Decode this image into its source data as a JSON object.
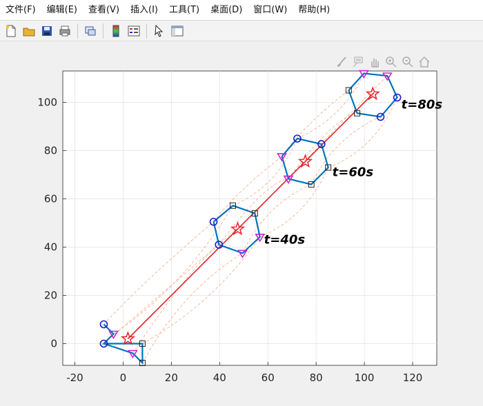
{
  "menubar": {
    "items": [
      "文件(F)",
      "编辑(E)",
      "查看(V)",
      "插入(I)",
      "工具(T)",
      "桌面(D)",
      "窗口(W)",
      "帮助(H)"
    ]
  },
  "toolbar": {
    "icons": [
      "new-figure-icon",
      "open-file-icon",
      "save-icon",
      "print-icon",
      "link-plot-icon",
      "insert-colorbar-icon",
      "insert-legend-icon",
      "pointer-icon",
      "property-editor-icon"
    ]
  },
  "axes_toolbar": {
    "icons": [
      "brush-icon",
      "data-tips-icon",
      "pan-icon",
      "zoom-in-icon",
      "zoom-out-icon",
      "home-icon"
    ]
  },
  "colors": {
    "formation_line": "#0072bd",
    "trajectory": "#d62728",
    "dashed_paths": "#f4a582",
    "circle_marker": "#1a1acc",
    "triangle_marker": "#cc22cc",
    "square_marker": "#222222",
    "star_marker": "#e8202a",
    "plot_bg": "#ffffff",
    "grid": "#e0e0e0"
  },
  "chart_data": {
    "type": "scatter",
    "title": "",
    "xlabel": "",
    "ylabel": "",
    "xlim": [
      -25,
      130
    ],
    "ylim": [
      -9,
      113
    ],
    "xticks": [
      -20,
      0,
      20,
      40,
      60,
      80,
      100,
      120
    ],
    "yticks": [
      0,
      20,
      40,
      60,
      80,
      100
    ],
    "grid": true,
    "leader_trajectory": [
      [
        2,
        2
      ],
      [
        104,
        104
      ]
    ],
    "formations": [
      {
        "label": "",
        "center": [
          2,
          2
        ],
        "polygon": [
          [
            -8,
            8
          ],
          [
            -4,
            4
          ],
          [
            -8,
            0
          ],
          [
            8,
            0
          ],
          [
            8,
            -8
          ],
          [
            4,
            -4
          ],
          [
            -8,
            0
          ]
        ],
        "circles": [
          [
            -8,
            8
          ],
          [
            -8,
            0
          ]
        ],
        "triangles": [
          [
            -4,
            4
          ],
          [
            4,
            -4
          ]
        ],
        "squares": [
          [
            8,
            0
          ],
          [
            8,
            -8
          ]
        ]
      },
      {
        "label": "t=40s",
        "center": [
          47.5,
          47.5
        ],
        "polygon": [
          [
            37.5,
            50.5
          ],
          [
            45.5,
            57.2
          ],
          [
            54.6,
            54
          ],
          [
            56.7,
            44.2
          ],
          [
            49.5,
            37.5
          ],
          [
            39.7,
            41
          ],
          [
            37.5,
            50.5
          ]
        ],
        "circles": [
          [
            37.5,
            50.5
          ],
          [
            39.7,
            41
          ]
        ],
        "triangles": [
          [
            56.7,
            44.2
          ],
          [
            49.5,
            37.5
          ]
        ],
        "squares": [
          [
            45.5,
            57.2
          ],
          [
            54.6,
            54
          ]
        ]
      },
      {
        "label": "t=60s",
        "center": [
          75.5,
          75.5
        ],
        "polygon": [
          [
            65.8,
            77.6
          ],
          [
            72.2,
            85
          ],
          [
            82.2,
            82.7
          ],
          [
            85,
            73
          ],
          [
            78,
            66
          ],
          [
            68.5,
            68.3
          ],
          [
            65.8,
            77.6
          ]
        ],
        "circles": [
          [
            72.2,
            85
          ],
          [
            82.2,
            82.7
          ]
        ],
        "triangles": [
          [
            65.8,
            77.6
          ],
          [
            68.5,
            68.3
          ]
        ],
        "squares": [
          [
            85,
            73
          ],
          [
            78,
            66
          ]
        ]
      },
      {
        "label": "t=80s",
        "center": [
          103.5,
          103.5
        ],
        "polygon": [
          [
            93.5,
            105
          ],
          [
            99.8,
            112
          ],
          [
            109.5,
            111
          ],
          [
            113.6,
            102
          ],
          [
            106.7,
            94
          ],
          [
            97,
            95.5
          ],
          [
            93.5,
            105
          ]
        ],
        "circles": [
          [
            113.6,
            102
          ],
          [
            106.7,
            94
          ]
        ],
        "triangles": [
          [
            99.8,
            112
          ],
          [
            109.5,
            111
          ]
        ],
        "squares": [
          [
            93.5,
            105
          ],
          [
            97,
            95.5
          ]
        ]
      }
    ]
  }
}
